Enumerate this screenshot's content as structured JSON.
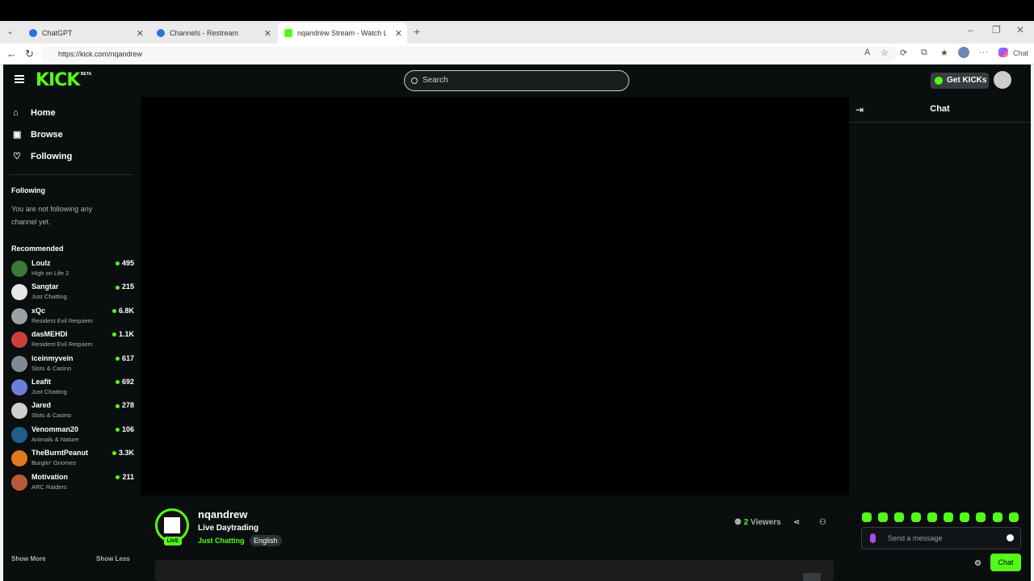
{
  "browser": {
    "tabs": [
      {
        "title": "ChatGPT",
        "favicon_color": "#2f6fe0",
        "active": false
      },
      {
        "title": "Channels - Restream",
        "favicon_color": "#2f6fe0",
        "active": false
      },
      {
        "title": "nqandrew Stream - Watch Live",
        "favicon_color": "#53fc18",
        "active": true
      }
    ],
    "url": "https://kick.com/nqandrew",
    "copilot_label": "Chat"
  },
  "header": {
    "logo": "KICK",
    "beta": "BETA",
    "search_placeholder": "Search",
    "get_kicks": "Get KICKs"
  },
  "sidebar": {
    "nav": [
      {
        "label": "Home",
        "icon": "home-icon"
      },
      {
        "label": "Browse",
        "icon": "browse-icon"
      },
      {
        "label": "Following",
        "icon": "heart-icon"
      }
    ],
    "following_title": "Following",
    "following_empty": "You are not following any channel yet.",
    "recommended_title": "Recommended",
    "recommended": [
      {
        "name": "Loulz",
        "category": "High on Life 2",
        "viewers": "495",
        "color": "#3d7a3a"
      },
      {
        "name": "Sangtar",
        "category": "Just Chatting",
        "viewers": "215",
        "color": "#e6e6e6"
      },
      {
        "name": "xQc",
        "category": "Resident Evil Requiem",
        "viewers": "6.8K",
        "color": "#9aa0a4"
      },
      {
        "name": "dasMEHDI",
        "category": "Resident Evil Requiem",
        "viewers": "1.1K",
        "color": "#c9423a"
      },
      {
        "name": "iceinmyvein",
        "category": "Slots & Casino",
        "viewers": "617",
        "color": "#7f8b93"
      },
      {
        "name": "Leafit",
        "category": "Just Chatting",
        "viewers": "692",
        "color": "#6a7fd8"
      },
      {
        "name": "Jared",
        "category": "Slots & Casino",
        "viewers": "278",
        "color": "#cfcfcf"
      },
      {
        "name": "Venomman20",
        "category": "Animals & Nature",
        "viewers": "106",
        "color": "#1d5e8a"
      },
      {
        "name": "TheBurntPeanut",
        "category": "Burglin' Gnomes",
        "viewers": "3.3K",
        "color": "#e07a1f"
      },
      {
        "name": "Motivation",
        "category": "ARC Raiders",
        "viewers": "211",
        "color": "#b85a3a"
      }
    ],
    "show_more": "Show More",
    "show_less": "Show Less"
  },
  "channel": {
    "name": "nqandrew",
    "title": "Live Daytrading",
    "category": "Just Chatting",
    "language": "English",
    "live_label": "LIVE",
    "viewers_count": "2",
    "viewers_label": "Viewers"
  },
  "chat": {
    "title": "Chat",
    "input_placeholder": "Send a message",
    "send_label": "Chat"
  },
  "colors": {
    "accent": "#53fc18",
    "background": "#0b0e0f"
  }
}
